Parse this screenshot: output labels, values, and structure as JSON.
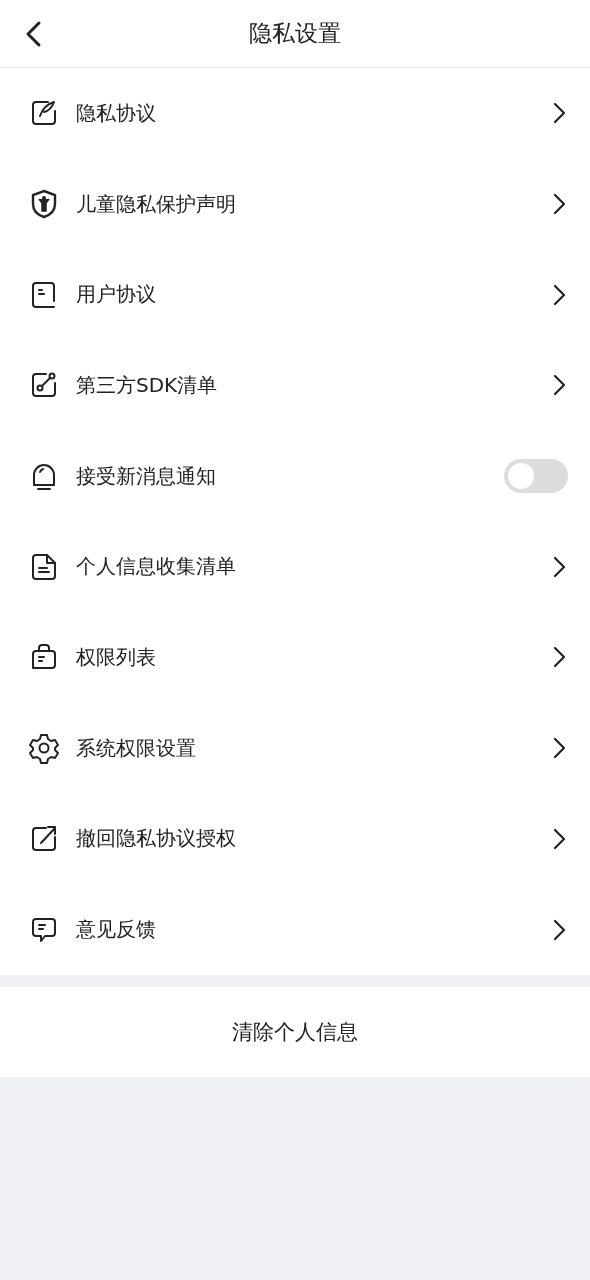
{
  "header": {
    "title": "隐私设置"
  },
  "items": [
    {
      "kind": "link",
      "label": "隐私协议"
    },
    {
      "kind": "link",
      "label": "儿童隐私保护声明"
    },
    {
      "kind": "link",
      "label": "用户协议"
    },
    {
      "kind": "link",
      "label": "第三方SDK清单"
    },
    {
      "kind": "toggle",
      "label": "接受新消息通知",
      "on": false
    },
    {
      "kind": "link",
      "label": "个人信息收集清单"
    },
    {
      "kind": "link",
      "label": "权限列表"
    },
    {
      "kind": "link",
      "label": "系统权限设置"
    },
    {
      "kind": "link",
      "label": "撤回隐私协议授权"
    },
    {
      "kind": "link",
      "label": "意见反馈"
    }
  ],
  "clear_button": {
    "label": "清除个人信息"
  }
}
